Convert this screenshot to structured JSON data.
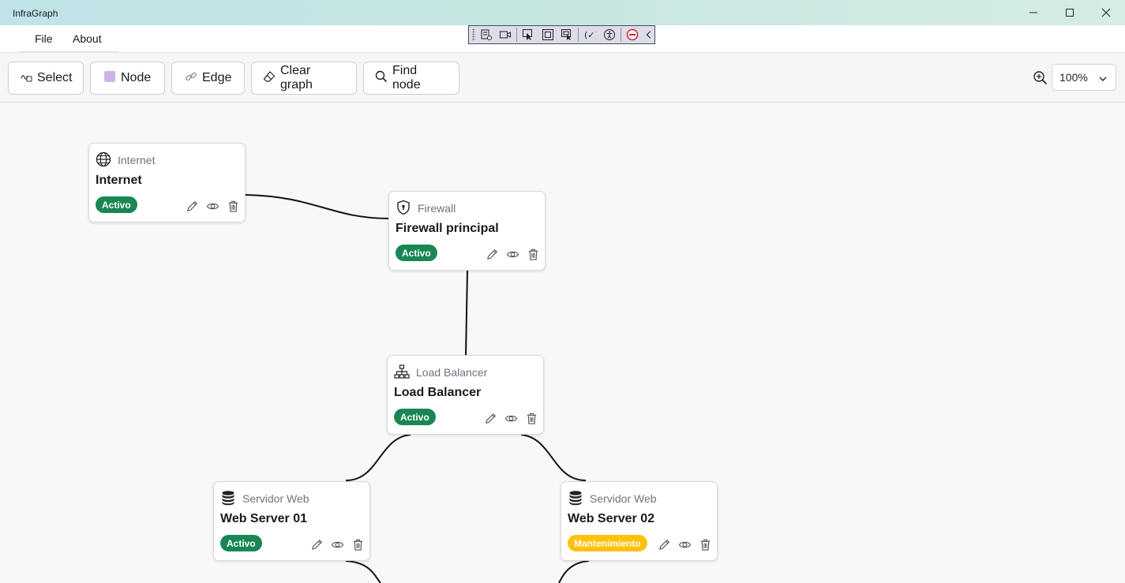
{
  "window": {
    "title": "InfraGraph",
    "controls": [
      "minimize-icon",
      "maximize-icon",
      "close-icon"
    ]
  },
  "debug_toolbar": {
    "icons": [
      "inspect-tree-icon",
      "record-icon",
      "select-element-icon",
      "display-layout-icon",
      "track-focus-icon",
      "binding-failures-icon",
      "accessibility-icon",
      "disable-icon",
      "collapse-icon"
    ]
  },
  "menu": {
    "items": [
      {
        "label": "File"
      },
      {
        "label": "About"
      }
    ]
  },
  "toolbar": {
    "buttons": [
      {
        "label": "Select",
        "icon": "select-cursor-icon"
      },
      {
        "label": "Node",
        "icon": "node-square-icon"
      },
      {
        "label": "Edge",
        "icon": "link-icon"
      },
      {
        "label": "Clear graph",
        "icon": "eraser-icon"
      },
      {
        "label": "Find node",
        "icon": "search-icon"
      }
    ],
    "zoom": {
      "icon": "zoom-in-icon",
      "value": "100%"
    }
  },
  "colors": {
    "active": "#198754",
    "maintenance": "#ffc107",
    "edge": "#111111"
  },
  "nodes": [
    {
      "id": "internet",
      "type": "Internet",
      "icon": "globe-icon",
      "name": "Internet",
      "status": "Activo",
      "status_kind": "active"
    },
    {
      "id": "firewall",
      "type": "Firewall",
      "icon": "shield-icon",
      "name": "Firewall principal",
      "status": "Activo",
      "status_kind": "active"
    },
    {
      "id": "lb",
      "type": "Load Balancer",
      "icon": "network-icon",
      "name": "Load Balancer",
      "status": "Activo",
      "status_kind": "active"
    },
    {
      "id": "ws1",
      "type": "Servidor Web",
      "icon": "database-icon",
      "name": "Web Server 01",
      "status": "Activo",
      "status_kind": "active"
    },
    {
      "id": "ws2",
      "type": "Servidor Web",
      "icon": "database-icon",
      "name": "Web Server 02",
      "status": "Mantenimiento",
      "status_kind": "maintenance"
    }
  ],
  "edges": [
    {
      "from": "internet",
      "to": "firewall"
    },
    {
      "from": "firewall",
      "to": "lb"
    },
    {
      "from": "lb",
      "to": "ws1"
    },
    {
      "from": "lb",
      "to": "ws2"
    }
  ],
  "node_actions": [
    "edit-pencil-icon",
    "view-eye-icon",
    "delete-trash-icon"
  ]
}
